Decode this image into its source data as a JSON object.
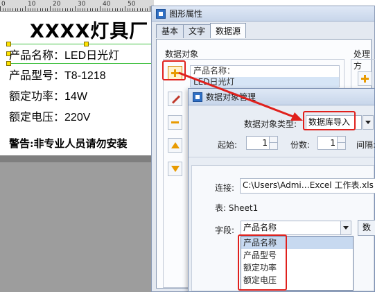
{
  "ruler": {
    "numbers": [
      "0",
      "10",
      "20",
      "30",
      "40",
      "50"
    ]
  },
  "label": {
    "title": "XXXX灯具厂",
    "lines": [
      {
        "key": "产品名称：",
        "value": "LED日光灯"
      },
      {
        "key": "产品型号：",
        "value": "T8-1218"
      },
      {
        "key": "额定功率：",
        "value": "14W"
      },
      {
        "key": "额定电压：",
        "value": "220V"
      }
    ],
    "warning": "警告:非专业人员请勿安装"
  },
  "properties_dialog": {
    "title": "图形属性",
    "tabs": [
      "基本",
      "文字",
      "数据源"
    ],
    "active_tab": "数据源",
    "data_objects_label": "数据对象",
    "processing_label": "处理方",
    "data_objects": [
      "产品名称：",
      "LED日光灯"
    ]
  },
  "manager_dialog": {
    "title": "数据对象管理",
    "type_label": "数据对象类型:",
    "type_value": "数据库导入",
    "start_label": "起始:",
    "start_value": "1",
    "copies_label": "份数:",
    "copies_value": "1",
    "interval_label": "间隔:",
    "connection_label": "连接:",
    "connection_value": "C:\\Users\\Admi…Excel 工作表.xls",
    "table_label": "表:",
    "table_value": "Sheet1",
    "field_label": "字段:",
    "field_value": "产品名称",
    "field_button_label": "数",
    "field_options": [
      "产品名称",
      "产品型号",
      "额定功率",
      "额定电压"
    ],
    "selected_option": "产品名称"
  },
  "colors": {
    "annotation": "#e0201c",
    "selection": "#42c142",
    "handle": "#ffe200"
  }
}
